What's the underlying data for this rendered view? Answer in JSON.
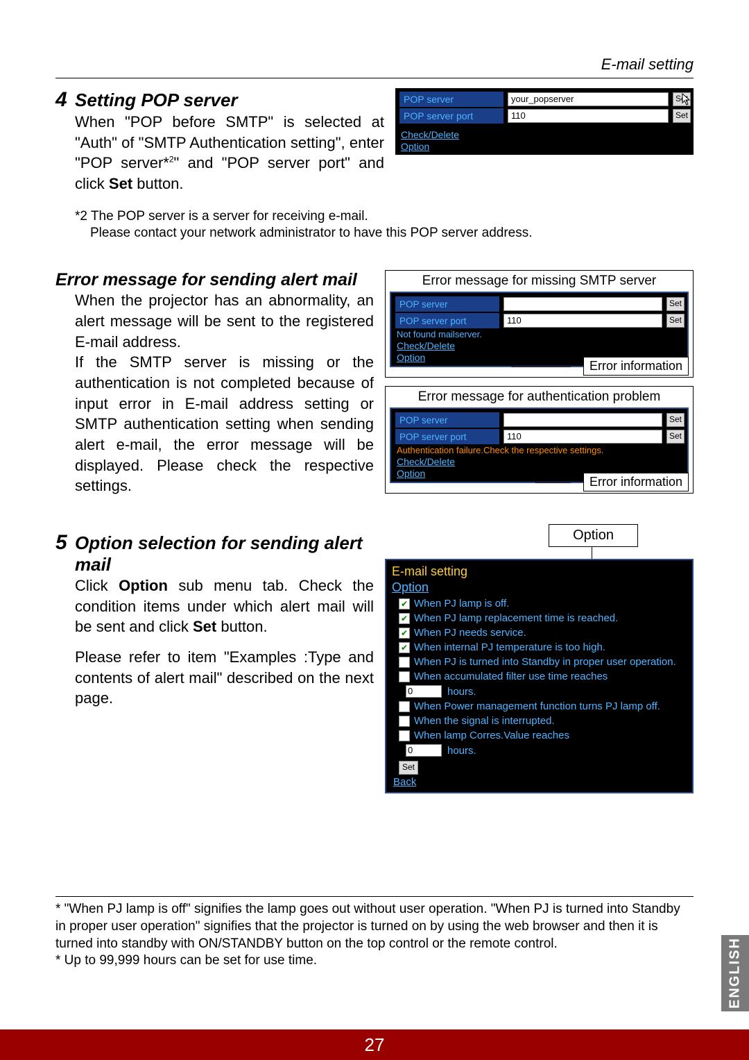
{
  "header": {
    "section": "E-mail setting"
  },
  "step4": {
    "num": "4",
    "title": "Setting POP server",
    "body": "When \"POP before SMTP\" is selected at \"Auth\" of \"SMTP Authentication setting\", enter \"POP server*²\" and \"POP server port\" and click Set button.",
    "note1": "*2 The POP server is a server for receiving e-mail.",
    "note2": "Please contact your network administrator to have this POP server address.",
    "fig": {
      "pop_server_label": "POP server",
      "pop_server_value": "your_popserver",
      "pop_port_label": "POP server port",
      "pop_port_value": "110",
      "set": "Set",
      "link1": "Check/Delete",
      "link2": "Option"
    }
  },
  "error_section": {
    "title": "Error message for sending alert mail",
    "p1": "When the projector has an abnormality, an alert message will be sent to the registered E-mail address.",
    "p2": "If the SMTP server is missing or the authentication is not completed because of input error in E-mail address setting or SMTP authentication setting when sending alert e-mail, the error message will be displayed. Please check the respective settings.",
    "fig1": {
      "caption": "Error message for missing SMTP server",
      "pop_server_label": "POP server",
      "pop_server_value": "",
      "pop_port_label": "POP server port",
      "pop_port_value": "110",
      "set": "Set",
      "err": "Not found mailserver.",
      "link1": "Check/Delete",
      "link2": "Option",
      "callout": "Error information"
    },
    "fig2": {
      "caption": "Error message for authentication problem",
      "pop_server_label": "POP server",
      "pop_server_value": "",
      "pop_port_label": "POP server port",
      "pop_port_value": "110",
      "set": "Set",
      "err": "Authentication failure.Check the respective settings.",
      "link1": "Check/Delete",
      "link2": "Option",
      "callout": "Error information"
    }
  },
  "step5": {
    "num": "5",
    "title": "Option selection for sending alert mail",
    "p1": "Click Option sub menu tab. Check the condition items under which alert mail will be sent and click Set button.",
    "p2": "Please refer to item \"Examples :Type and contents of alert mail\" described on the next page.",
    "tab_label": "Option",
    "panel": {
      "hd1": "E-mail setting",
      "hd2": "Option",
      "items": [
        {
          "checked": true,
          "text": "When PJ lamp is off."
        },
        {
          "checked": true,
          "text": "When PJ lamp replacement time is reached."
        },
        {
          "checked": true,
          "text": "When PJ needs service."
        },
        {
          "checked": true,
          "text": "When internal PJ temperature is too high."
        },
        {
          "checked": false,
          "text": "When PJ is turned into Standby in proper user operation."
        },
        {
          "checked": false,
          "text": "When accumulated filter use time reaches"
        }
      ],
      "hours1_value": "0",
      "hours_label": "hours.",
      "item7": {
        "checked": false,
        "text": "When Power management function turns PJ lamp off."
      },
      "item8": {
        "checked": false,
        "text": "When the signal is interrupted."
      },
      "item9": {
        "checked": false,
        "text": "When lamp Corres.Value reaches"
      },
      "hours2_value": "0",
      "set": "Set",
      "back": "Back"
    }
  },
  "footnotes": {
    "f1": "* \"When PJ lamp is off\" signifies the lamp goes out without user operation. \"When PJ is turned into Standby  in proper user operation\" signifies that the projector is turned on by using the web browser and then it is turned into standby with ON/STANDBY button on the top control or the remote control.",
    "f2": "* Up to 99,999 hours can be set for use time."
  },
  "pagenum": "27",
  "sidetab": "ENGLISH"
}
